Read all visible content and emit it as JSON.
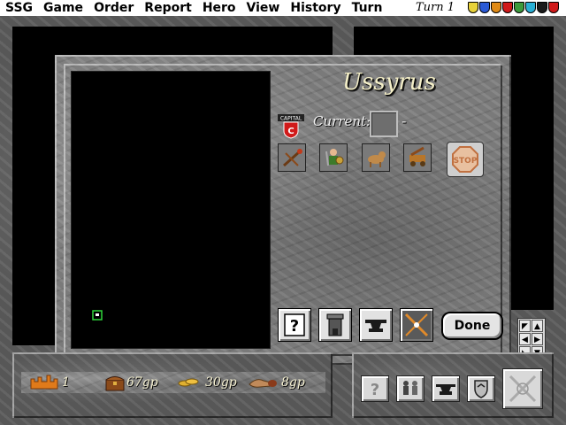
{
  "menu": {
    "items": [
      "SSG",
      "Game",
      "Order",
      "Report",
      "Hero",
      "View",
      "History",
      "Turn"
    ],
    "turn_label": "Turn",
    "turn_number": "1"
  },
  "player_shields": [
    "#e8d23a",
    "#2a5ad6",
    "#e08a16",
    "#d01a1a",
    "#3d9a3d",
    "#2ab0d6",
    "#1a1a1a",
    "#d01a1a"
  ],
  "city": {
    "name": "Ussyrus",
    "badge_text": "CAPITAL",
    "badge_letter": "C",
    "current_label": "Current:",
    "current_value": "-",
    "production_units": [
      "catapult-like-unit-icon",
      "dwarf-warrior-icon",
      "wolf-icon",
      "siege-unit-icon"
    ],
    "stop_label": "STOP"
  },
  "dialog_buttons": {
    "info": "?",
    "done_label": "Done"
  },
  "status": {
    "cities_count": "1",
    "gold_treasury": "67gp",
    "income": "30gp",
    "upkeep": "8gp"
  },
  "command_panel": {
    "info": "?"
  }
}
